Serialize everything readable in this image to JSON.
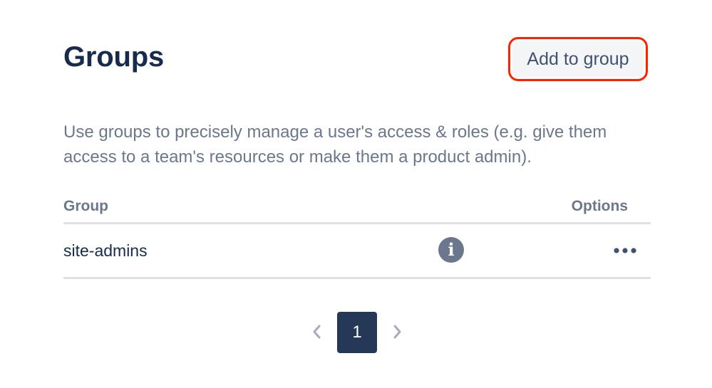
{
  "header": {
    "title": "Groups",
    "add_button_label": "Add to group"
  },
  "description": "Use groups to precisely manage a user's access & roles (e.g. give them access to a team's resources or make them a product admin).",
  "table": {
    "columns": [
      "Group",
      "Options"
    ],
    "rows": [
      {
        "group": "site-admins",
        "info_icon": "info-icon",
        "options_icon": "more-horizontal-icon"
      }
    ]
  },
  "pagination": {
    "current_page": "1",
    "prev_icon": "chevron-left-icon",
    "next_icon": "chevron-right-icon"
  },
  "colors": {
    "title": "#172b4d",
    "secondary_text": "#6b778c",
    "highlight_border": "#ff2200",
    "button_bg": "#f4f5f7",
    "divider": "#dfe1e6",
    "current_page_bg": "#253858"
  }
}
